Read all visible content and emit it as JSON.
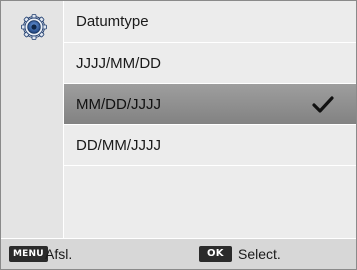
{
  "header": {
    "icon": "gear-icon",
    "title": "Datumtype"
  },
  "options": [
    {
      "label": "JJJJ/MM/DD",
      "selected": false
    },
    {
      "label": "MM/DD/JJJJ",
      "selected": true
    },
    {
      "label": "DD/MM/JJJJ",
      "selected": false
    }
  ],
  "footer": {
    "menu_key": "MENU",
    "back_label": "Afsl.",
    "ok_key": "OK",
    "select_label": "Select."
  },
  "colors": {
    "selected_row": "#8e8e8e",
    "accent": "#2a4f86"
  }
}
